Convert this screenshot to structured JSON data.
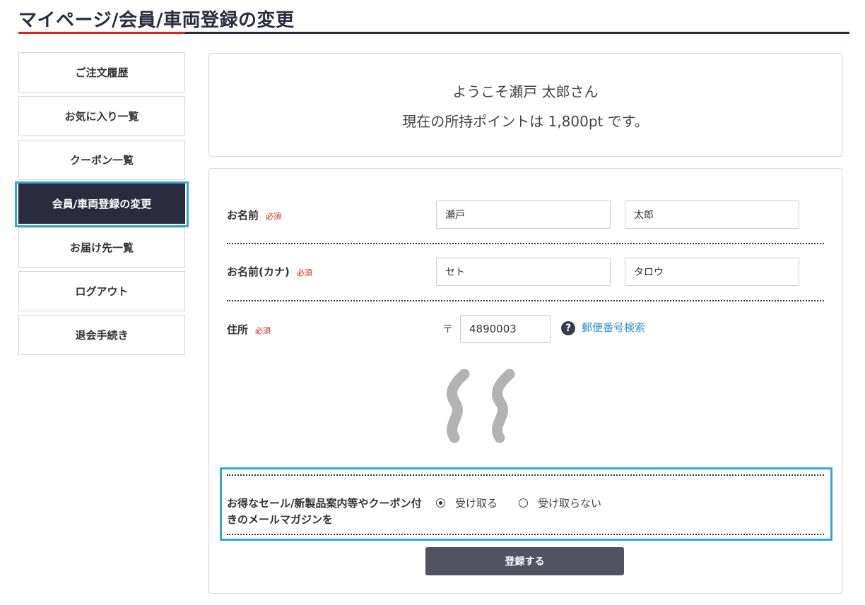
{
  "page": {
    "title": "マイページ/会員/車両登録の変更"
  },
  "sidebar": {
    "items": [
      {
        "label": "ご注文履歴"
      },
      {
        "label": "お気に入り一覧"
      },
      {
        "label": "クーポン一覧"
      },
      {
        "label": "会員/車両登録の変更",
        "active": true
      },
      {
        "label": "お届け先一覧"
      },
      {
        "label": "ログアウト"
      },
      {
        "label": "退会手続き"
      }
    ]
  },
  "welcome": {
    "greeting": "ようこそ瀬戸 太郎さん",
    "points": "現在の所持ポイントは 1,800pt です。"
  },
  "form": {
    "required_label": "必須",
    "name": {
      "label": "お名前",
      "last": "瀬戸",
      "first": "太郎"
    },
    "kana": {
      "label": "お名前(カナ)",
      "last": "セト",
      "first": "タロウ"
    },
    "address": {
      "label": "住所",
      "postal_mark": "〒",
      "postal_code": "4890003",
      "zip_search_link": "郵便番号検索"
    },
    "mail_magazine": {
      "label": "お得なセール/新製品案内等やクーポン付きのメールマガジンを",
      "options": [
        {
          "label": "受け取る",
          "checked": true
        },
        {
          "label": "受け取らない",
          "checked": false
        }
      ]
    },
    "submit_label": "登録する"
  },
  "colors": {
    "accent": "#d9261c",
    "navy": "#2a2b3d",
    "highlight": "#36a5dc",
    "link": "#2e8fcf"
  },
  "icons": {
    "help": "question-circle-icon",
    "omission": "omission-wave-icon"
  }
}
